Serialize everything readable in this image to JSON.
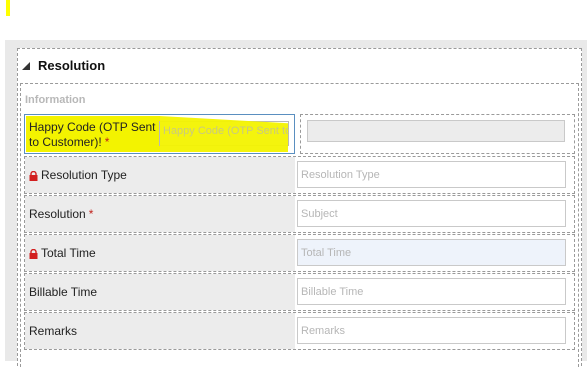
{
  "section": {
    "title": "Resolution",
    "subsection_title": "Information"
  },
  "happy": {
    "label": "Happy Code (OTP Sent to Customer)!",
    "required_marker": "*",
    "placeholder": "Happy Code (OTP Sent to Customer)!"
  },
  "rows": [
    {
      "label": "Resolution Type",
      "locked": true,
      "required": false,
      "placeholder": "Resolution Type"
    },
    {
      "label": "Resolution",
      "locked": false,
      "required": true,
      "required_marker": "*",
      "placeholder": "Subject"
    },
    {
      "label": "Total Time",
      "locked": true,
      "required": false,
      "placeholder": "Total Time"
    },
    {
      "label": "Billable Time",
      "locked": false,
      "required": false,
      "placeholder": "Billable Time"
    },
    {
      "label": "Remarks",
      "locked": false,
      "required": false,
      "placeholder": "Remarks"
    }
  ],
  "colors": {
    "highlight": "#f3f300",
    "required": "#c0211b",
    "lock": "#d21f1f",
    "focus_border": "#5a8fc0"
  },
  "icons": {
    "collapse": "collapse-triangle-icon",
    "lock": "lock-icon"
  }
}
